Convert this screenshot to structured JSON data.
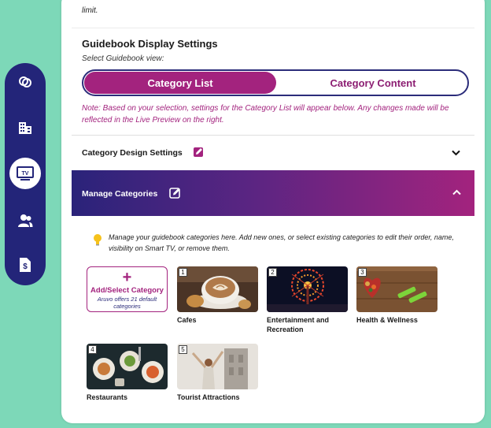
{
  "top_note": "limit.",
  "guidebook": {
    "title": "Guidebook Display Settings",
    "subtitle": "Select Guidebook view:",
    "options": [
      "Category List",
      "Category Content"
    ],
    "selected": "Category List",
    "note": "Note: Based on your selection, settings for the Category List will appear below. Any changes made will be reflected in the Live Preview on the right."
  },
  "sections": {
    "design": "Category Design Settings",
    "manage": "Manage Categories"
  },
  "manage": {
    "help": "Manage your guidebook categories here. Add new ones, or select existing categories to edit their order, name, visibility on Smart TV, or remove them.",
    "add_plus": "+",
    "add_label": "Add/Select Category",
    "add_sub": "Aruvo offers 21 default categories",
    "categories": [
      {
        "num": "1",
        "label": "Cafes"
      },
      {
        "num": "2",
        "label": "Entertainment and Recreation"
      },
      {
        "num": "3",
        "label": "Health & Wellness"
      },
      {
        "num": "4",
        "label": "Restaurants"
      },
      {
        "num": "5",
        "label": "Tourist Attractions"
      }
    ]
  },
  "rail": {
    "items": [
      "rings-icon",
      "building-icon",
      "tv-icon",
      "users-icon",
      "dollar-doc-icon"
    ],
    "active": "tv-icon",
    "tv_text": "TV"
  },
  "colors": {
    "accent": "#a3237e",
    "navy": "#232579",
    "background": "#7dd8b8"
  }
}
